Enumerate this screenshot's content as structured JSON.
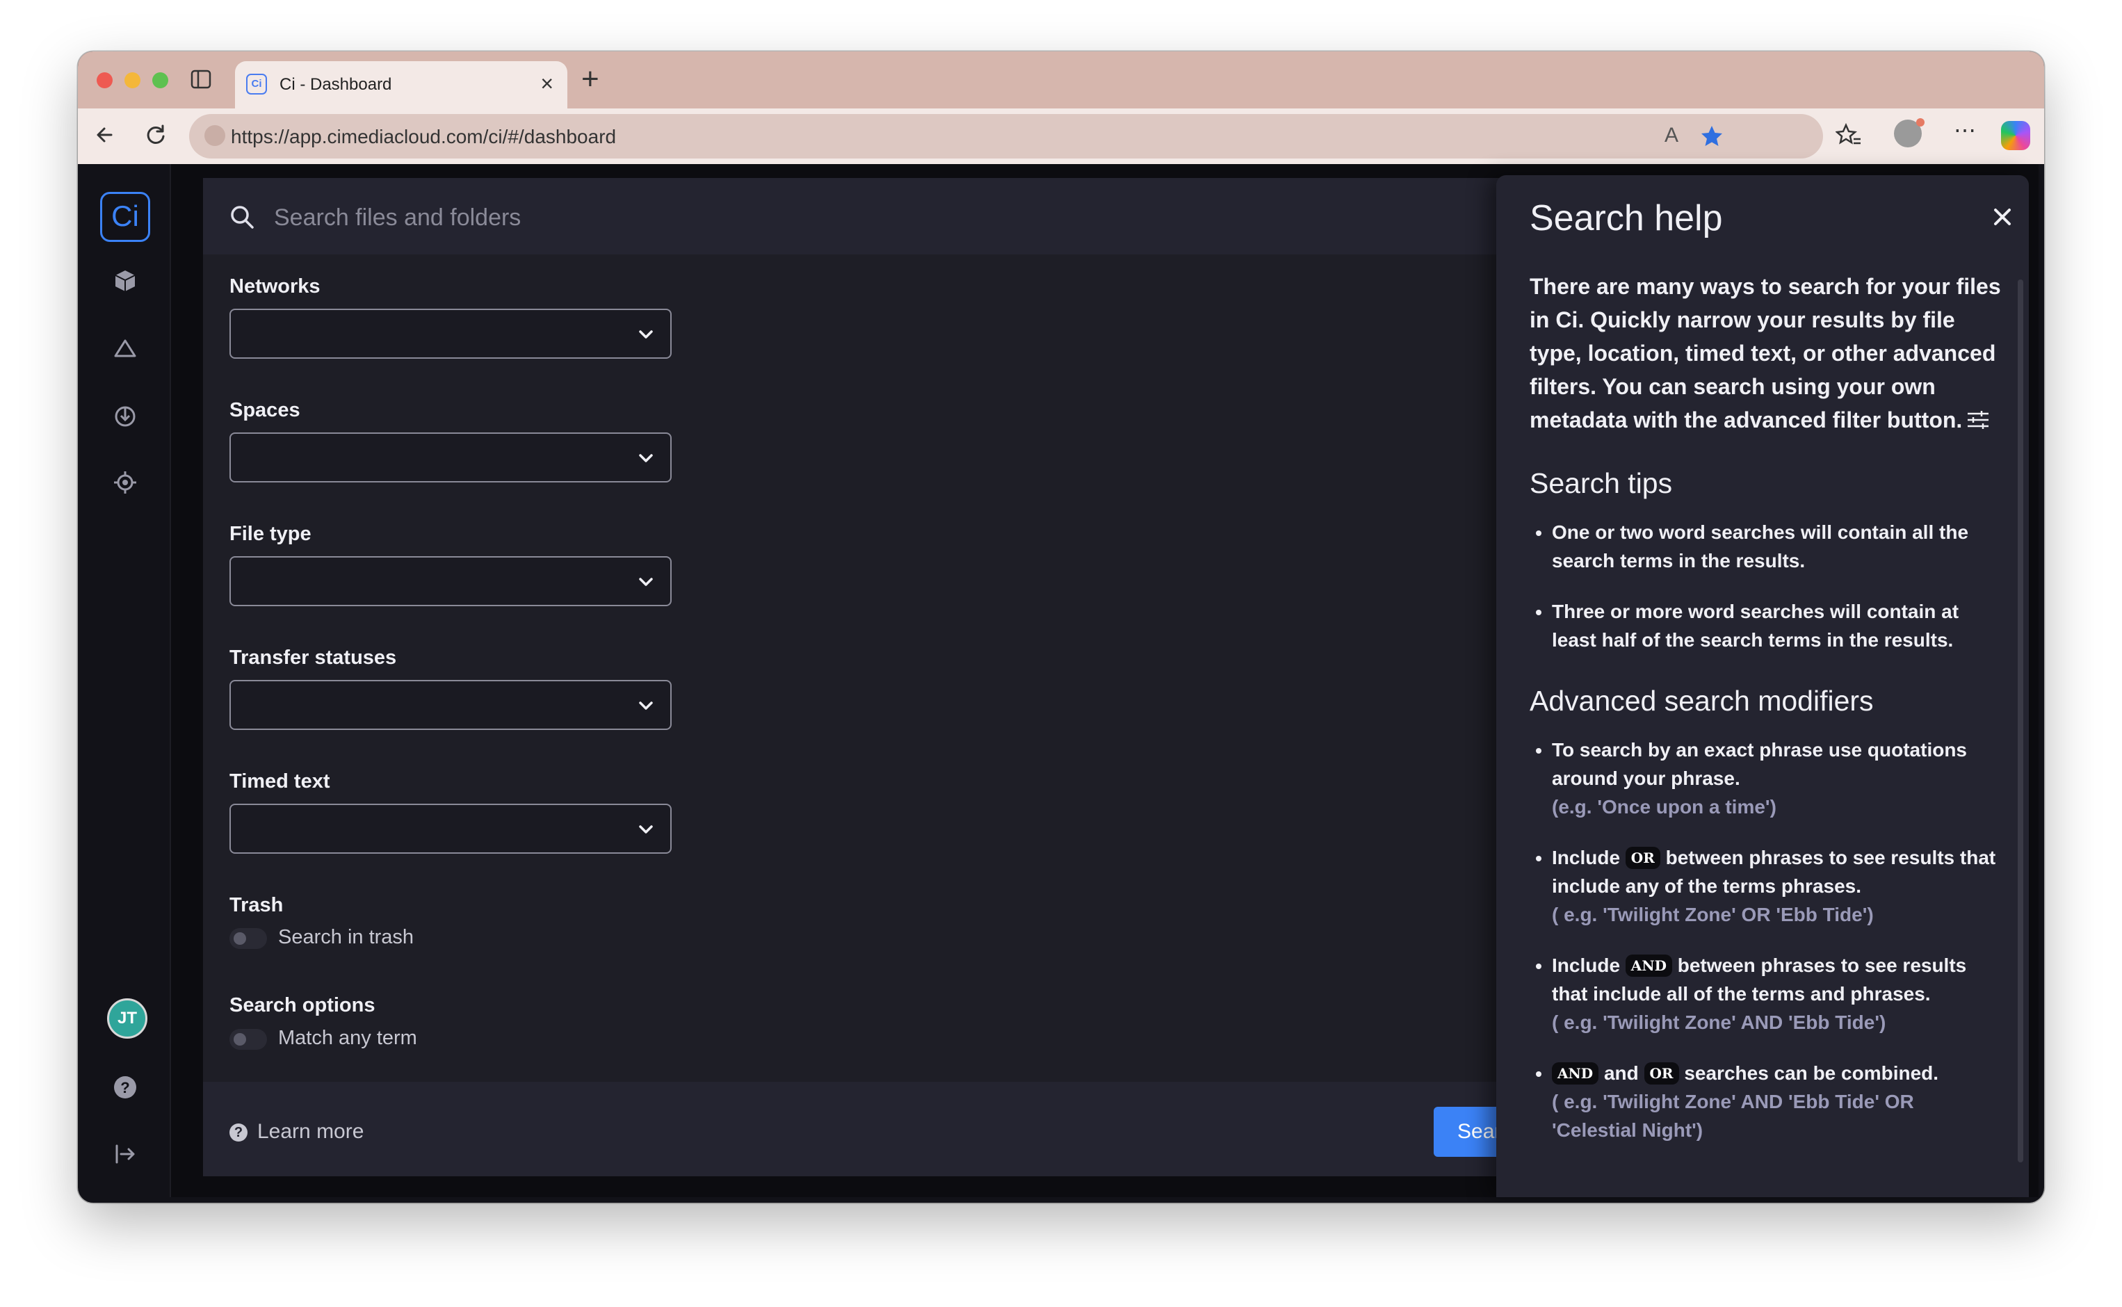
{
  "browser": {
    "tab_title": "Ci - Dashboard",
    "tab_favicon": "Ci",
    "url": "https://app.cimediacloud.com/ci/#/dashboard",
    "new_tab": "+",
    "tab_close": "×"
  },
  "app": {
    "logo": "Ci",
    "user_initials": "JT",
    "rail_icons": [
      "cube-icon",
      "cloud-icon",
      "power-icon",
      "target-icon",
      "help-icon",
      "logout-icon"
    ]
  },
  "search": {
    "placeholder": "Search files and folders",
    "fields": [
      {
        "label": "Networks"
      },
      {
        "label": "Spaces"
      },
      {
        "label": "File type"
      },
      {
        "label": "Transfer statuses"
      },
      {
        "label": "Timed text"
      }
    ],
    "trash_label": "Trash",
    "trash_toggle": "Search in trash",
    "options_label": "Search options",
    "options_toggle": "Match any term",
    "learn_more": "Learn more",
    "search_button": "Sear"
  },
  "help": {
    "title": "Search help",
    "intro": "There are many ways to search for your files in Ci. Quickly narrow your results by file type, location, timed text, or other advanced filters. You can search using your own metadata with the advanced filter button.",
    "tips_heading": "Search tips",
    "tips": [
      "One or two word searches will contain all the search terms in the results.",
      "Three or more word searches will contain at least half of the search terms in the results."
    ],
    "modifiers_heading": "Advanced search modifiers",
    "m1_text": "To search by an exact phrase use quotations around your phrase.",
    "m1_example": "(e.g. 'Once upon a time')",
    "m2_pre": "Include",
    "m2_kbd": "OR",
    "m2_post": "between phrases to see results that include any of the terms phrases.",
    "m2_example": "( e.g. 'Twilight Zone' OR 'Ebb Tide')",
    "m3_pre": "Include",
    "m3_kbd": "AND",
    "m3_post": "between phrases to see results that include all of the terms and phrases.",
    "m3_example": "( e.g. 'Twilight Zone' AND 'Ebb Tide')",
    "m4_kbd1": "AND",
    "m4_and": "and",
    "m4_kbd2": "OR",
    "m4_post": "searches can be combined.",
    "m4_example": "( e.g. 'Twilight Zone' AND 'Ebb Tide' OR 'Celestial Night')"
  }
}
